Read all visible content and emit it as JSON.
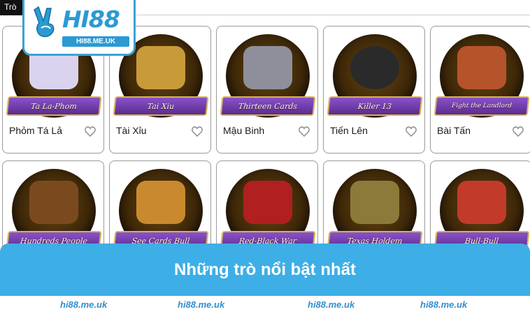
{
  "topbar": {
    "tab_label": "Trò"
  },
  "logo": {
    "brand": "HI88",
    "domain": "HI88.ME.UK"
  },
  "games_row1": [
    {
      "name": "Phỏm Tá Lả",
      "ribbon": "Ta La-Phom",
      "accent": "#d9d3ee"
    },
    {
      "name": "Tài Xỉu",
      "ribbon": "Tai Xiu",
      "accent": "#c99a3a"
    },
    {
      "name": "Mậu Binh",
      "ribbon": "Thirteen Cards",
      "accent": "#8f8f9c"
    },
    {
      "name": "Tiến Lên",
      "ribbon": "Killer 13",
      "accent": "#2a2a2a"
    },
    {
      "name": "Bài Tấn",
      "ribbon": "Fight the Landlord",
      "accent": "#b5542a"
    }
  ],
  "games_row2": [
    {
      "ribbon": "Hundreds People",
      "accent": "#7a4a1e"
    },
    {
      "ribbon": "See Cards Bull",
      "accent": "#c98a2f"
    },
    {
      "ribbon": "Red-Black War",
      "accent": "#b02020"
    },
    {
      "ribbon": "Texas Holdem",
      "accent": "#8c7a3a"
    },
    {
      "ribbon": "Bull-Bull",
      "accent": "#c23a2a"
    }
  ],
  "banner": {
    "title": "Những trò nổi bật nhất"
  },
  "footer": {
    "watermarks": [
      "hi88.me.uk",
      "hi88.me.uk",
      "hi88.me.uk",
      "hi88.me.uk"
    ]
  },
  "colors": {
    "brand_blue": "#3eaee6",
    "ribbon_purple": "#6b3aa6",
    "gold": "#d9a93a"
  }
}
